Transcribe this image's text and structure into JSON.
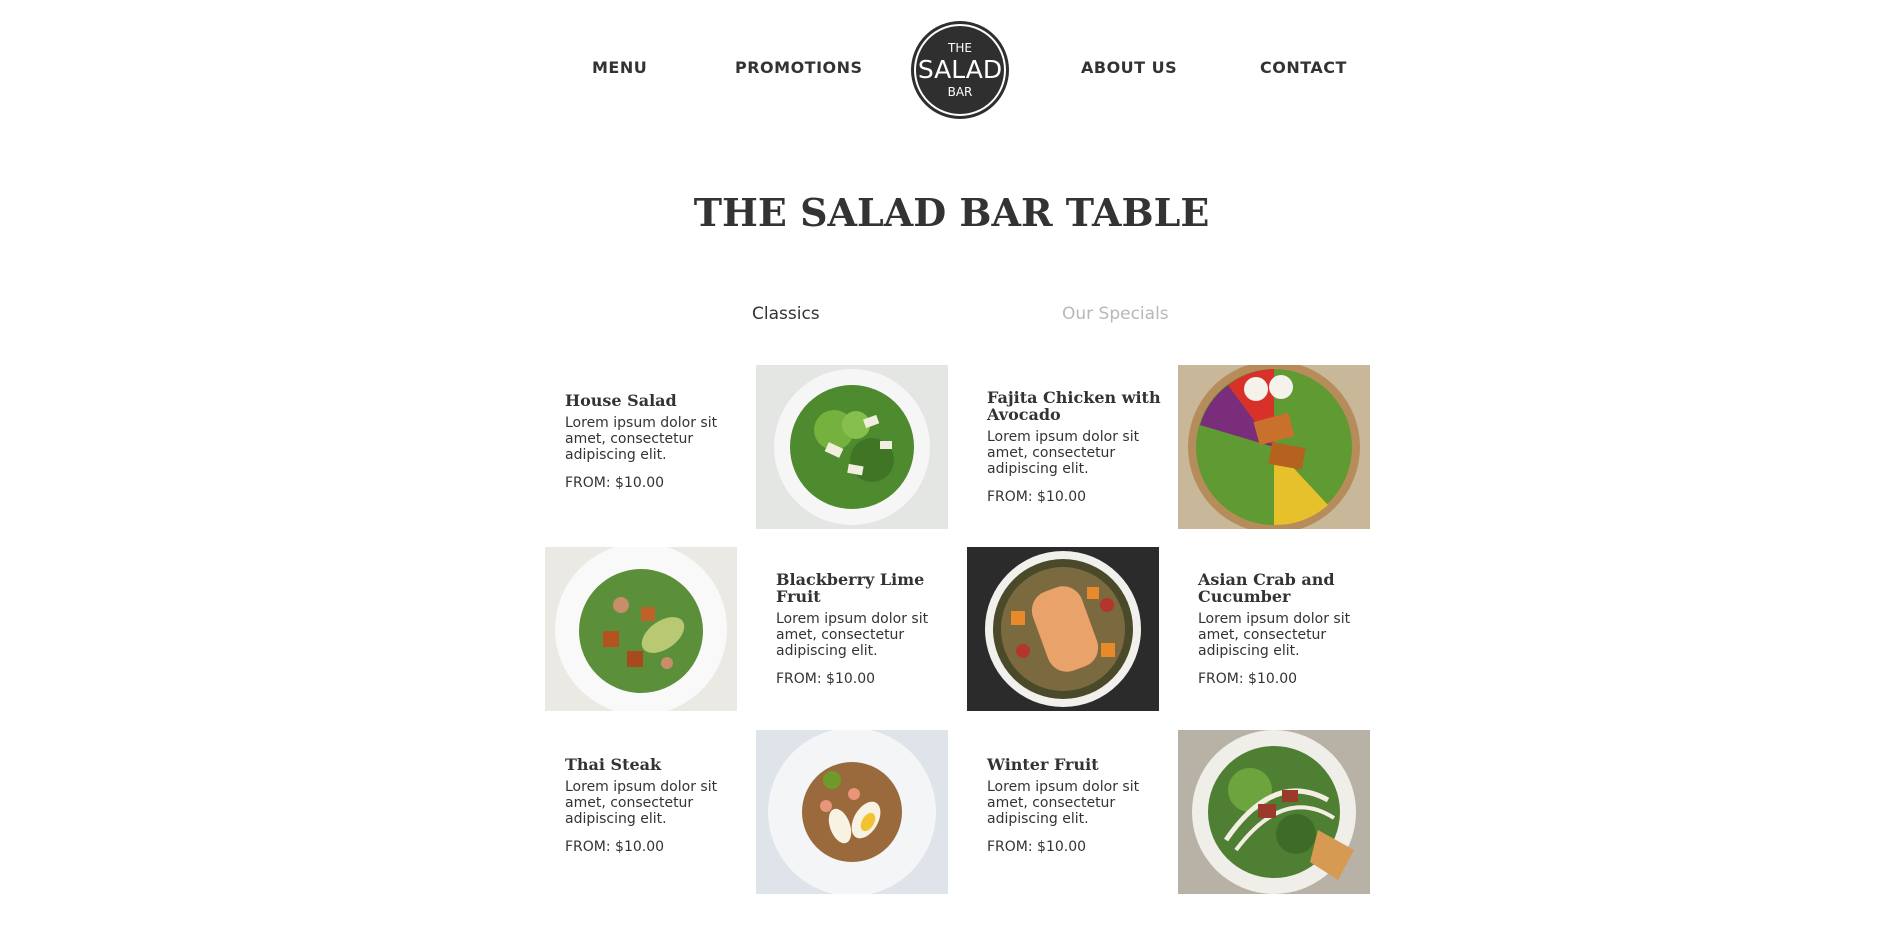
{
  "nav": {
    "left": [
      "MENU",
      "PROMOTIONS"
    ],
    "right": [
      "ABOUT US",
      "CONTACT"
    ],
    "logo": {
      "top": "THE",
      "middle": "SALAD",
      "bottom": "BAR"
    }
  },
  "page": {
    "title": "THE SALAD BAR TABLE"
  },
  "tabs": [
    {
      "label": "Classics",
      "active": true
    },
    {
      "label": "Our Specials",
      "active": false
    }
  ],
  "items": [
    {
      "name": "House Salad",
      "description": "Lorem ipsum dolor sit amet, consectetur adipiscing elit.",
      "price": "FROM: $10.00"
    },
    {
      "name": "Fajita Chicken with Avocado",
      "description": "Lorem ipsum dolor sit amet, consectetur adipiscing elit.",
      "price": "FROM: $10.00"
    },
    {
      "name": "Blackberry Lime Fruit",
      "description": "Lorem ipsum dolor sit amet, consectetur adipiscing elit.",
      "price": "FROM: $10.00"
    },
    {
      "name": "Asian Crab and Cucumber",
      "description": "Lorem ipsum dolor sit amet, consectetur adipiscing elit.",
      "price": "FROM: $10.00"
    },
    {
      "name": "Thai Steak",
      "description": "Lorem ipsum dolor sit amet, consectetur adipiscing elit.",
      "price": "FROM: $10.00"
    },
    {
      "name": "Winter Fruit",
      "description": "Lorem ipsum dolor sit amet, consectetur adipiscing elit.",
      "price": "FROM: $10.00"
    }
  ],
  "colors": {
    "text": "#333333",
    "inactive_tab": "#b8b8b8",
    "logo_bg": "#2f2f2f"
  }
}
